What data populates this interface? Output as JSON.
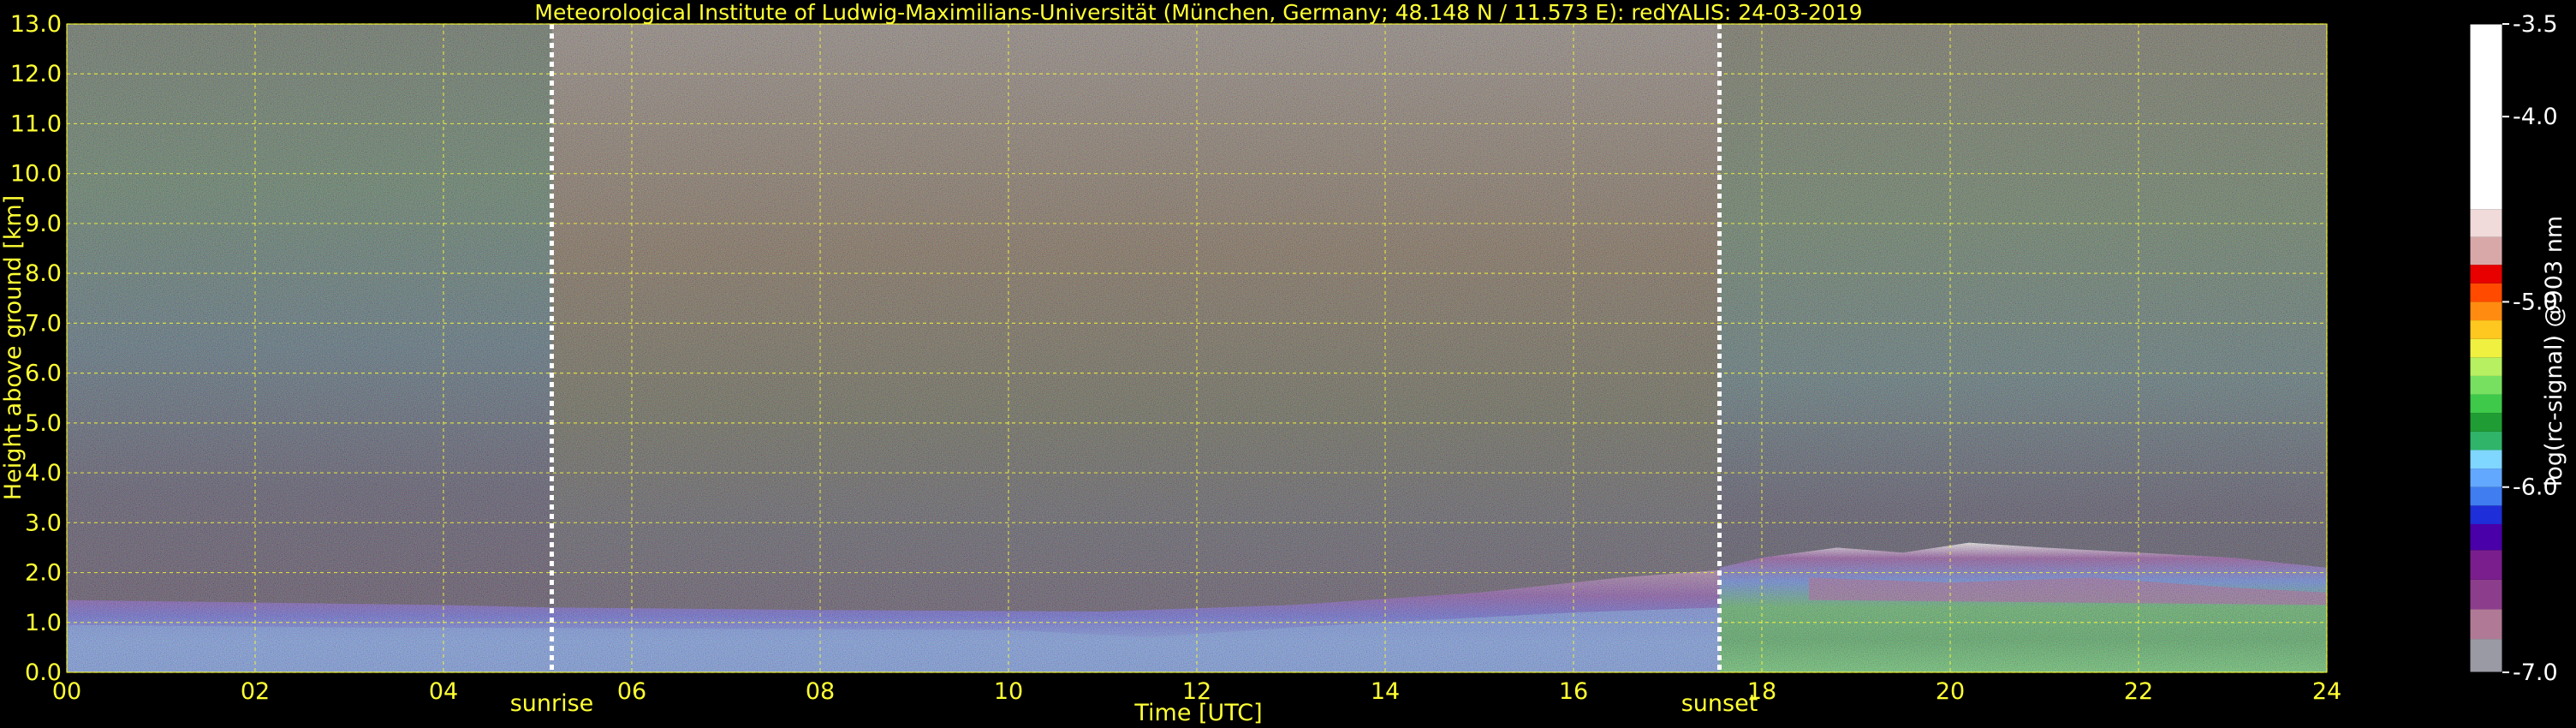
{
  "chart_data": {
    "type": "heatmap",
    "title": "Meteorological Institute of Ludwig-Maximilians-Universität (München, Germany; 48.148 N / 11.573 E):    redYALIS: 24-03-2019",
    "xlabel": "Time [UTC]",
    "ylabel": "Height above ground [km]",
    "xlim": [
      0,
      24
    ],
    "ylim": [
      0,
      13
    ],
    "x_ticks": [
      "00",
      "02",
      "04",
      "06",
      "08",
      "10",
      "12",
      "14",
      "16",
      "18",
      "20",
      "22",
      "24"
    ],
    "y_ticks": [
      "0.0",
      "1.0",
      "2.0",
      "3.0",
      "4.0",
      "5.0",
      "6.0",
      "7.0",
      "8.0",
      "9.0",
      "10.0",
      "11.0",
      "12.0",
      "13.0"
    ],
    "grid": true,
    "markers": [
      {
        "label": "sunrise",
        "x": 5.15
      },
      {
        "label": "sunset",
        "x": 17.55
      }
    ],
    "colorbar": {
      "label": "log(rc-signal) @903 nm",
      "min": -7.0,
      "max": -3.5,
      "ticks": [
        "-3.5",
        "-4.0",
        "-5.0",
        "-6.0",
        "-7.0"
      ],
      "tick_values": [
        -3.5,
        -4.0,
        -5.0,
        -6.0,
        -7.0
      ],
      "colors": [
        "#9a9aa4",
        "#b07a96",
        "#8c3e8c",
        "#7a1e8e",
        "#4a00a8",
        "#1e2ed8",
        "#3f7df0",
        "#62a8ff",
        "#7fd6ff",
        "#30b46a",
        "#1f9d34",
        "#3ec94a",
        "#78e060",
        "#b7f060",
        "#f0f040",
        "#ffc820",
        "#ff8c10",
        "#ff4a00",
        "#e80000",
        "#d8a8a8",
        "#f0dada",
        "#ffffff"
      ],
      "color_bounds": [
        -7.0,
        -6.82,
        -6.66,
        -6.5,
        -6.34,
        -6.2,
        -6.1,
        -6.0,
        -5.9,
        -5.8,
        -5.7,
        -5.6,
        -5.5,
        -5.4,
        -5.3,
        -5.2,
        -5.1,
        -5.0,
        -4.9,
        -4.8,
        -4.65,
        -4.5,
        -3.5
      ]
    },
    "grid_color": "#ffff33",
    "text_color": "#ffff33"
  }
}
